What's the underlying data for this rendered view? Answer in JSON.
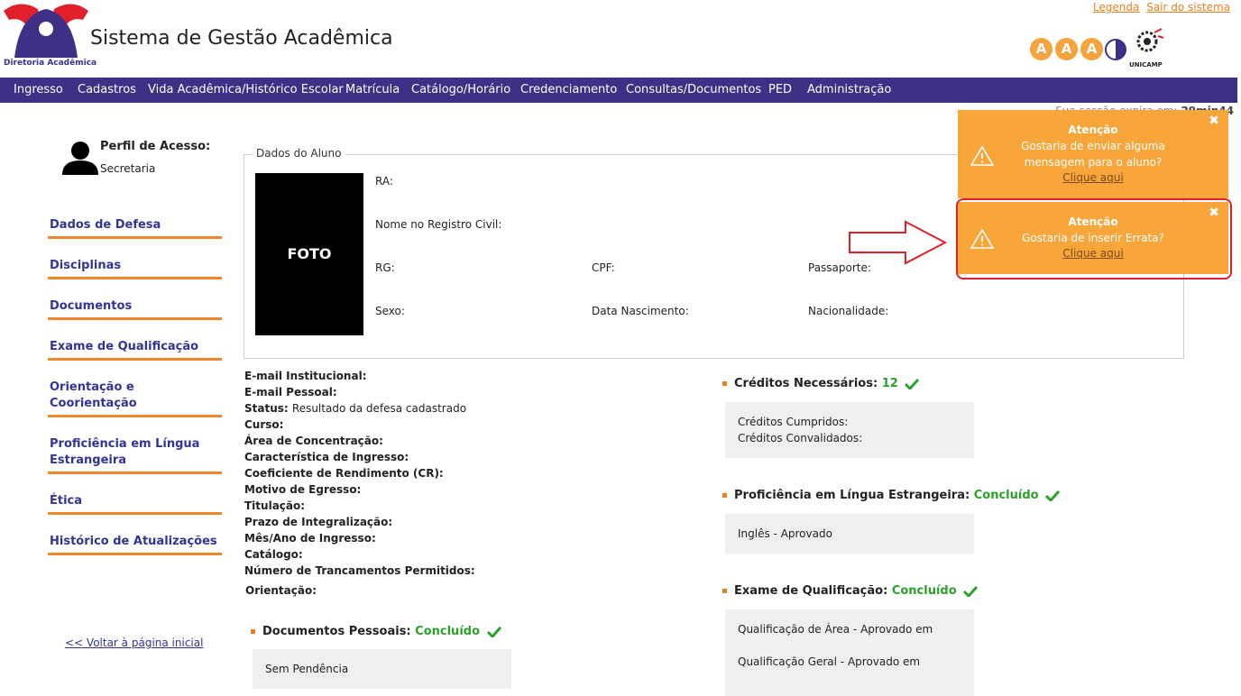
{
  "header": {
    "logo_caption": "Diretoria Acadêmica",
    "app_title": "Sistema de Gestão Acadêmica",
    "top_links": [
      "Legenda",
      "Sair do sistema"
    ],
    "unicamp_label": "UNICAMP",
    "aaa_letters": [
      "A",
      "A",
      "A"
    ]
  },
  "nav": {
    "items": [
      "Ingresso",
      "Cadastros",
      "Vida Acadêmica/Histórico Escolar",
      "Matrícula",
      "Catálogo/Horário",
      "Credenciamento",
      "Consultas/Documentos",
      "PED",
      "Administração"
    ],
    "bg_color": "#3f2f86"
  },
  "session": {
    "label": "Sua sessão expira em:",
    "value": "29min44"
  },
  "profile": {
    "label": "Perfil de Acesso:",
    "value": "Secretaria",
    "icon": "user-icon"
  },
  "sidebar": {
    "items": [
      {
        "label": "Dados de Defesa"
      },
      {
        "label": "Disciplinas"
      },
      {
        "label": "Documentos"
      },
      {
        "label": "Exame de Qualificação"
      },
      {
        "label": "Orientação e Coorientação"
      },
      {
        "label": "Proficiência em Língua Estrangeira"
      },
      {
        "label": "Ética"
      },
      {
        "label": "Histórico de Atualizações"
      }
    ],
    "back_link": "<< Voltar à página inicial",
    "accent_color": "#f0872c"
  },
  "dados_aluno": {
    "legend": "Dados do Aluno",
    "foto_label": "FOTO",
    "fields": {
      "ra": "RA:",
      "nome": "Nome no Registro Civil:",
      "rg": "RG:",
      "cpf": "CPF:",
      "passaporte": "Passaporte:",
      "sexo": "Sexo:",
      "data_nascimento": "Data Nascimento:",
      "nacionalidade": "Nacionalidade:"
    }
  },
  "details": [
    {
      "label": "E-mail Institucional:",
      "value": ""
    },
    {
      "label": "E-mail Pessoal:",
      "value": ""
    },
    {
      "label": "Status:",
      "value": "Resultado da defesa cadastrado"
    },
    {
      "label": "Curso:",
      "value": ""
    },
    {
      "label": "Área de Concentração:",
      "value": ""
    },
    {
      "label": "Característica de Ingresso:",
      "value": ""
    },
    {
      "label": "Coeficiente de Rendimento (CR):",
      "value": ""
    },
    {
      "label": "Motivo de Egresso:",
      "value": ""
    },
    {
      "label": "Titulação:",
      "value": ""
    },
    {
      "label": "Prazo de Integralização:",
      "value": ""
    },
    {
      "label": "Mês/Ano de Ingresso:",
      "value": ""
    },
    {
      "label": "Catálogo:",
      "value": ""
    },
    {
      "label": "Número de Trancamentos Permitidos:",
      "value": ""
    },
    {
      "label": "Orientação:",
      "value": ""
    }
  ],
  "sections": {
    "documentos_pessoais": {
      "title": "Documentos Pessoais:",
      "status": "Concluído",
      "lines": [
        "Sem Pendência"
      ]
    },
    "creditos": {
      "title": "Créditos Necessários:",
      "status": "12",
      "lines": [
        "Créditos Cumpridos:",
        "Créditos Convalidados:"
      ]
    },
    "proficiencia": {
      "title": "Proficiência em Língua Estrangeira:",
      "status": "Concluído",
      "lines": [
        "Inglês - Aprovado"
      ]
    },
    "qualificacao": {
      "title": "Exame de Qualificação:",
      "status": "Concluído",
      "lines": [
        "Qualificação de Área - Aprovado em",
        "Qualificação Geral - Aprovado em"
      ]
    },
    "status_color": "#2ca02c"
  },
  "notifications": [
    {
      "title": "Atenção",
      "message_lines": [
        "Gostaria de enviar alguma",
        "mensagem para o aluno?"
      ],
      "link": "Clique aqui",
      "close": "✖",
      "icon": "warning-icon"
    },
    {
      "title": "Atenção",
      "message_lines": [
        "Gostaria de inserir Errata?"
      ],
      "link": "Clique aqui",
      "close": "✖",
      "icon": "warning-icon"
    }
  ],
  "colors": {
    "notification_bg": "#f8a63a",
    "highlight_outline": "#e0202a",
    "link_orange": "#e8801f"
  }
}
